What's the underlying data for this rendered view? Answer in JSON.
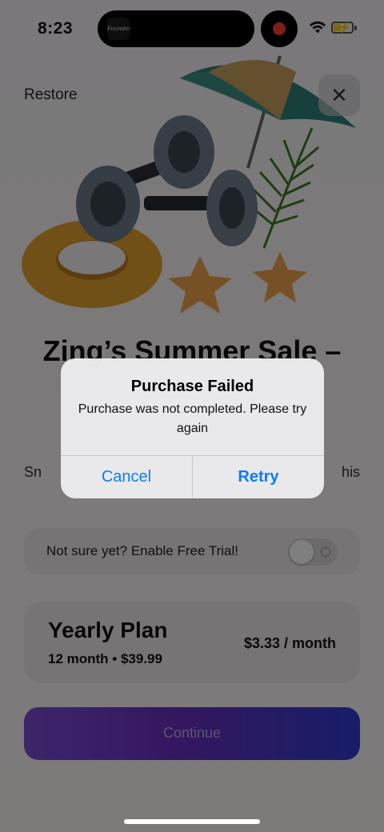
{
  "status_bar": {
    "time": "8:23",
    "island_app_label": "Founders"
  },
  "header": {
    "restore_label": "Restore",
    "close_glyph": "✕"
  },
  "hero": {
    "illustration": "summer-fitness-illustration"
  },
  "sale": {
    "title": "Zing’s Summer Sale –",
    "subtitle_start": "Sn",
    "subtitle_end": "his"
  },
  "trial": {
    "label": "Not sure yet? Enable Free Trial!",
    "enabled": false
  },
  "plan": {
    "name": "Yearly Plan",
    "detail": "12 month • $39.99",
    "price": "$3.33 / month"
  },
  "continue": {
    "label": "Continue"
  },
  "alert": {
    "title": "Purchase Failed",
    "message": "Purchase was not completed. Please try again",
    "cancel_label": "Cancel",
    "retry_label": "Retry"
  },
  "colors": {
    "alert_button": "#0a7cff",
    "continue_gradient_start": "#7b4bd6",
    "continue_gradient_end": "#2f3bd0",
    "recording": "#ff3b30"
  }
}
